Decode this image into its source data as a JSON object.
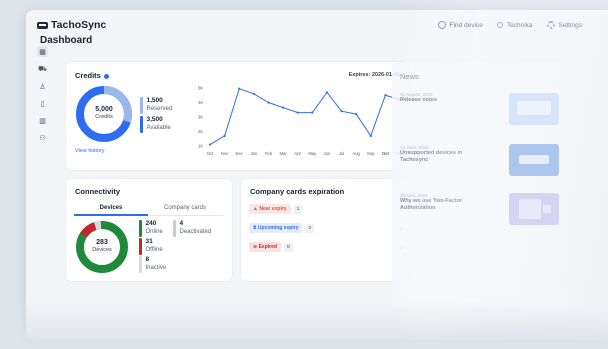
{
  "app": {
    "brand": "TachoSync"
  },
  "topbar": {
    "find_device": "Find device",
    "company": "Technika",
    "settings": "Settings"
  },
  "sidebar": {
    "items": [
      {
        "icon": "dashboard-icon",
        "active": true
      },
      {
        "icon": "truck-icon"
      },
      {
        "icon": "driver-icon"
      },
      {
        "icon": "document-icon"
      },
      {
        "icon": "building-icon"
      },
      {
        "icon": "users-icon"
      }
    ]
  },
  "page": {
    "title": "Dashboard"
  },
  "credits": {
    "title": "Credits",
    "expires": "Expires: 2026-01-01",
    "total": "5,000",
    "total_label": "Credits",
    "reserved_value": "1,500",
    "reserved_label": "Reserved",
    "available_value": "3,500",
    "available_label": "Available",
    "view_history": "View history",
    "colors": {
      "reserved": "#9ab8ec",
      "available": "#2f6df0"
    }
  },
  "chart_data": {
    "type": "line",
    "categories": [
      "Oct",
      "Nov",
      "Dec",
      "Jan",
      "Feb",
      "Mar",
      "Apr",
      "May",
      "Jun",
      "Jul",
      "Aug",
      "Sep",
      "Oct",
      "Nov"
    ],
    "yticks": [
      "1K",
      "2K",
      "3K",
      "4K",
      "5K"
    ],
    "ylim": [
      1000,
      5000
    ],
    "series": [
      {
        "values": [
          1100,
          1700,
          4950,
          4600,
          4000,
          3650,
          3300,
          3300,
          4700,
          3400,
          3200,
          1700,
          4500,
          4200
        ]
      }
    ],
    "color": "#2f6df0"
  },
  "connectivity": {
    "title": "Connectivity",
    "tabs": [
      "Devices",
      "Company cards"
    ],
    "total": "283",
    "total_label": "Devices",
    "online_value": "240",
    "online_label": "Online",
    "deactivated_value": "4",
    "deactivated_label": "Deactivated",
    "offline_value": "31",
    "offline_label": "Offline",
    "inactive_value": "8",
    "inactive_label": "Inactive",
    "colors": {
      "online": "#1f8a3a",
      "offline": "#c0282b",
      "deactivated": "#c9cdd3",
      "inactive": "#d8dbe0"
    }
  },
  "expiration": {
    "title": "Company cards expiration",
    "rows": [
      {
        "label": "Near expiry",
        "count": "1",
        "color": "#d9534f",
        "bg": "#fde7e4",
        "icon": "warning-icon"
      },
      {
        "label": "Upcoming expiry",
        "count": "2",
        "color": "#2f6df0",
        "bg": "#e4ecfd",
        "icon": "hourglass-icon"
      },
      {
        "label": "Expired",
        "count": "0",
        "color": "#c0282b",
        "bg": "#fbe2e2",
        "icon": "minus-circle-icon"
      }
    ]
  },
  "news": {
    "title": "News",
    "items": [
      {
        "date": "31 August, 2025",
        "head": "Release notes",
        "color": "#c9dcf8"
      },
      {
        "date": "13 June, 2025",
        "head": "Unsupported devices in Tachosync",
        "color": "#8fb1e8"
      },
      {
        "date": "30 April, 2025",
        "head": "Why we use Two-Factor Authorization",
        "color": "#c7c4ef"
      }
    ]
  }
}
